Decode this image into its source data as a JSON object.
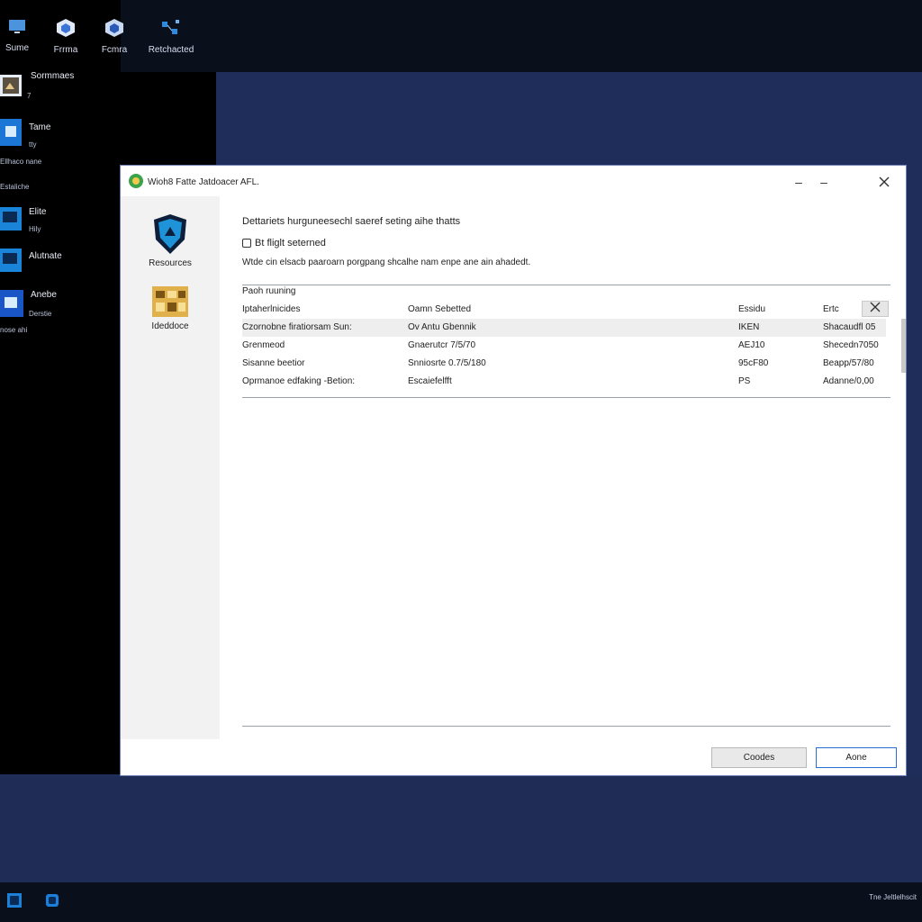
{
  "colors": {
    "desktop": "#1e2d5a",
    "topbar": "#0a0f1c",
    "window_border": "#6c7fb0",
    "primary_button_border": "#2b6ed1"
  },
  "desktop_icons": [
    {
      "label": "Sume",
      "icon": "monitor-icon"
    },
    {
      "label": "Frrma",
      "icon": "cube-icon"
    },
    {
      "label": "Fcmra",
      "icon": "cube-icon"
    },
    {
      "label": "Retchacted",
      "icon": "network-icon"
    }
  ],
  "left_panel": {
    "items": [
      {
        "label": "Sormmaes",
        "sub": "7",
        "icon": "photo-icon"
      },
      {
        "label": "Tame",
        "sub": "tty",
        "icon": "folder-icon"
      },
      {
        "label": "",
        "sub": "Ellhaco nane",
        "icon": ""
      },
      {
        "label": "",
        "sub": "Estaliche",
        "icon": ""
      },
      {
        "label": "Elite",
        "sub": "Hily",
        "icon": "display-icon"
      },
      {
        "label": "Alutnate",
        "sub": "",
        "icon": "display-icon"
      },
      {
        "label": "Anebe",
        "sub": "Derstie",
        "icon": "folder-icon"
      },
      {
        "label": "",
        "sub": "nose ahi",
        "icon": ""
      }
    ]
  },
  "window": {
    "title": "Wioh8 Fatte Jatdoacer AFL.",
    "sidebar": {
      "items": [
        {
          "label": "Resources",
          "icon": "shield-icon"
        },
        {
          "label": "Ideddoce",
          "icon": "grid-icon"
        }
      ]
    },
    "heading": "Dettariets hurguneesechl saeref seting aihe thatts",
    "subheading": "Bt fliglt seterned",
    "description": "Wtde cin elsacb paaroarn porgpang shcalhe nam enpe ane ain ahadedt.",
    "section_label": "Paoh ruuning",
    "table": {
      "headers": [
        "Iptaherlnicides",
        "Oamn Sebetted",
        "Essidu",
        "Ertc"
      ],
      "rows": [
        [
          "Czornobne firatiorsam Sun:",
          "Ov Antu Gbennik",
          "IKEN",
          "Shacaudfl 05"
        ],
        [
          "Grenmeod",
          "Gnaerutcr 7/5/70",
          "AEJ10",
          "Shecedn7050"
        ],
        [
          "Sisanne beetior",
          "Snniosrte 0.7/5/180",
          "95cF80",
          "Beapp/57/80"
        ],
        [
          "Oprmanoe edfaking -Betion:",
          "Escaiefelfft",
          "PS",
          "Adanne/0,00"
        ]
      ]
    },
    "buttons": {
      "secondary": "Coodes",
      "primary": "Aone"
    }
  },
  "taskbar": {
    "tray_text": "Tne Jeltlelhscit"
  }
}
